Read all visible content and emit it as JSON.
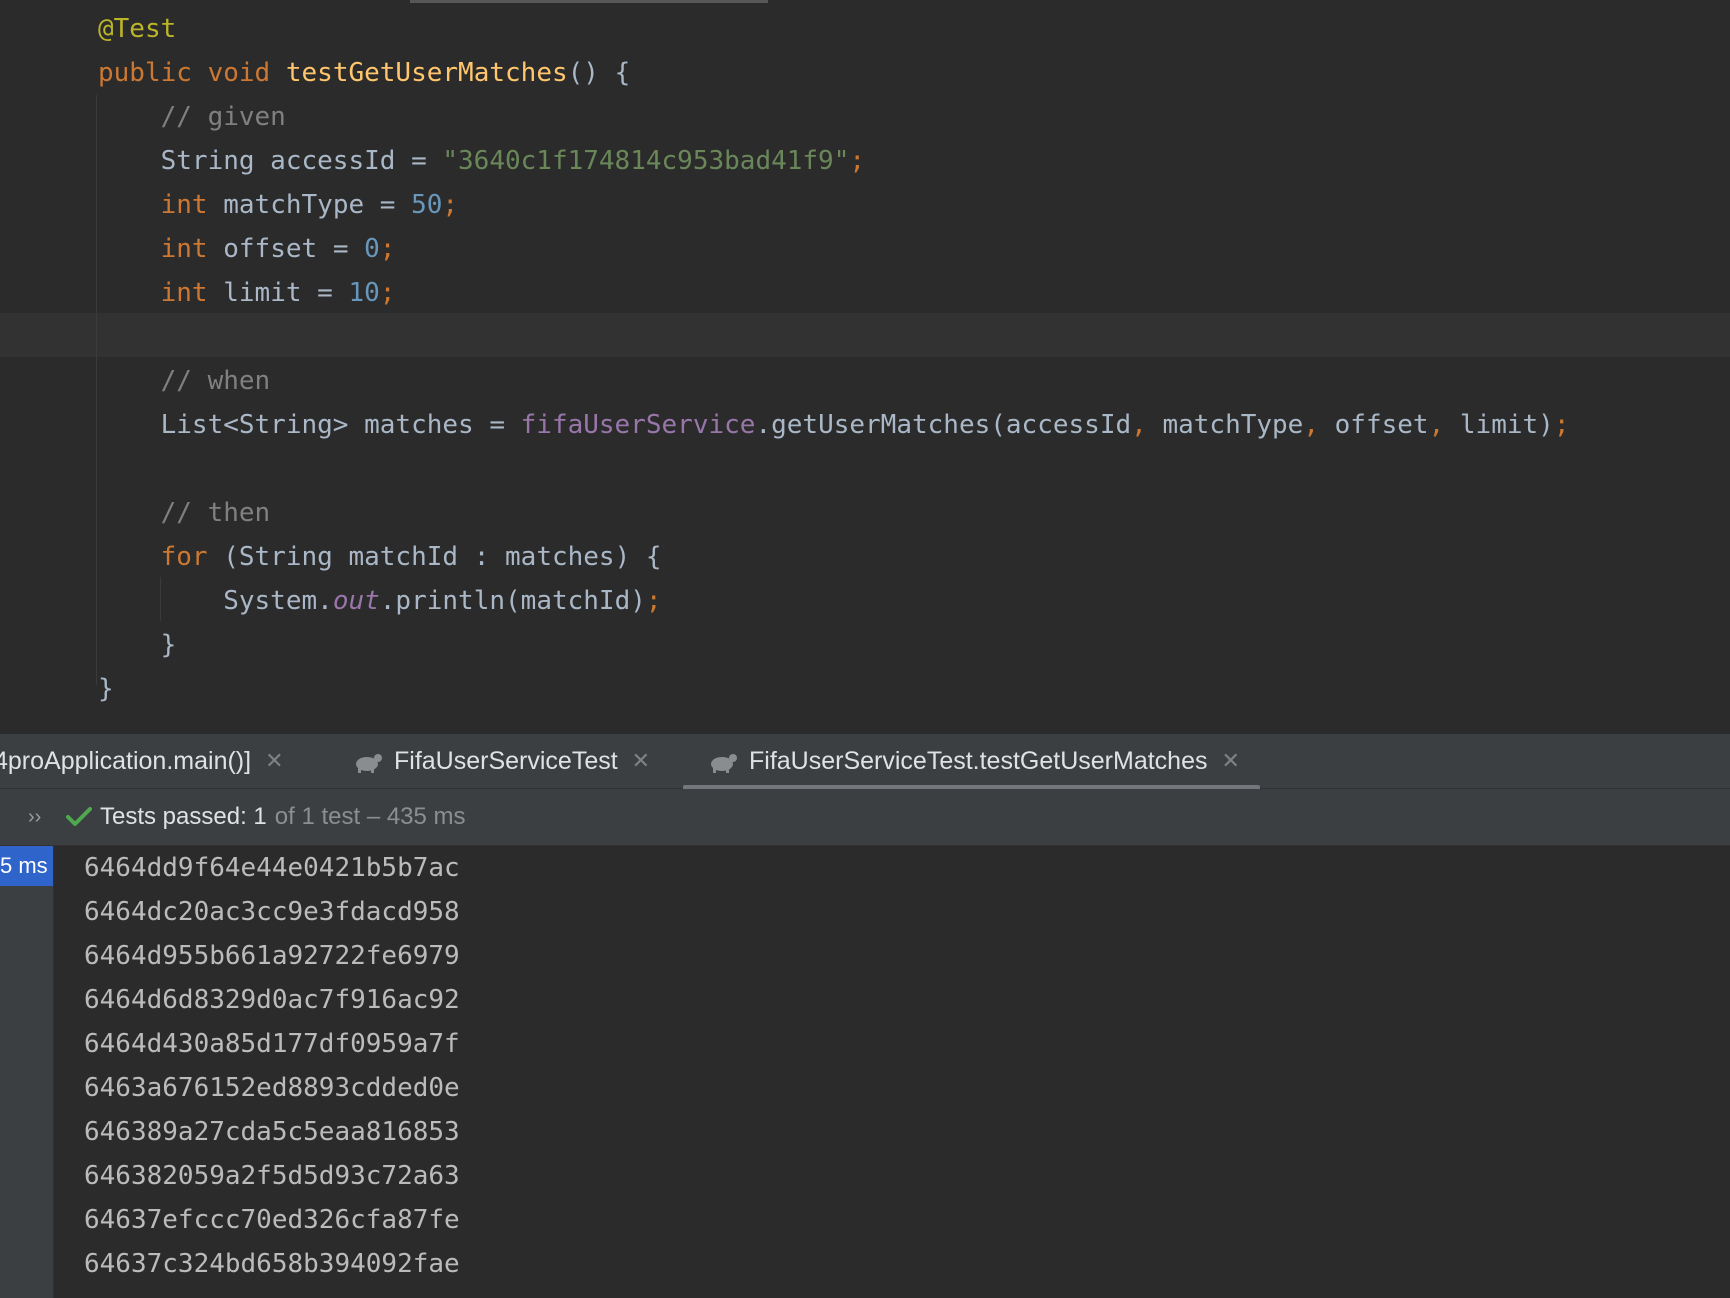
{
  "editor": {
    "lines": [
      [
        {
          "t": "@Test",
          "c": "ann"
        }
      ],
      [
        {
          "t": "public ",
          "c": "kw"
        },
        {
          "t": "void ",
          "c": "kw"
        },
        {
          "t": "testGetUserMatches",
          "c": "fn"
        },
        {
          "t": "() {",
          "c": "pl"
        }
      ],
      [
        {
          "t": "    // given",
          "c": "cmt"
        }
      ],
      [
        {
          "t": "    String accessId = ",
          "c": "pl"
        },
        {
          "t": "\"3640c1f174814c953bad41f9\"",
          "c": "str"
        },
        {
          "t": ";",
          "c": "kw"
        }
      ],
      [
        {
          "t": "    ",
          "c": "pl"
        },
        {
          "t": "int ",
          "c": "kw"
        },
        {
          "t": "matchType = ",
          "c": "pl"
        },
        {
          "t": "50",
          "c": "num"
        },
        {
          "t": ";",
          "c": "kw"
        }
      ],
      [
        {
          "t": "    ",
          "c": "pl"
        },
        {
          "t": "int ",
          "c": "kw"
        },
        {
          "t": "offset = ",
          "c": "pl"
        },
        {
          "t": "0",
          "c": "num"
        },
        {
          "t": ";",
          "c": "kw"
        }
      ],
      [
        {
          "t": "    ",
          "c": "pl"
        },
        {
          "t": "int ",
          "c": "kw"
        },
        {
          "t": "limit = ",
          "c": "pl"
        },
        {
          "t": "10",
          "c": "num"
        },
        {
          "t": ";",
          "c": "kw"
        }
      ],
      [
        {
          "t": "",
          "c": "pl"
        }
      ],
      [
        {
          "t": "    // when",
          "c": "cmt"
        }
      ],
      [
        {
          "t": "    List<String> matches = ",
          "c": "pl"
        },
        {
          "t": "fifaUserService",
          "c": "fld"
        },
        {
          "t": ".getUserMatches(accessId",
          "c": "pl"
        },
        {
          "t": ", ",
          "c": "kw"
        },
        {
          "t": "matchType",
          "c": "pl"
        },
        {
          "t": ", ",
          "c": "kw"
        },
        {
          "t": "offset",
          "c": "pl"
        },
        {
          "t": ", ",
          "c": "kw"
        },
        {
          "t": "limit)",
          "c": "pl"
        },
        {
          "t": ";",
          "c": "kw"
        }
      ],
      [
        {
          "t": "",
          "c": "pl"
        }
      ],
      [
        {
          "t": "    // then",
          "c": "cmt"
        }
      ],
      [
        {
          "t": "    ",
          "c": "pl"
        },
        {
          "t": "for ",
          "c": "kw"
        },
        {
          "t": "(String matchId : matches) {",
          "c": "pl"
        }
      ],
      [
        {
          "t": "        System.",
          "c": "pl"
        },
        {
          "t": "out",
          "c": "sfld"
        },
        {
          "t": ".println(matchId)",
          "c": "pl"
        },
        {
          "t": ";",
          "c": "kw"
        }
      ],
      [
        {
          "t": "    }",
          "c": "pl"
        }
      ],
      [
        {
          "t": "}",
          "c": "pl"
        }
      ]
    ]
  },
  "run_tabs": [
    {
      "label": "4proApplication.main()]",
      "icon": "",
      "active": false
    },
    {
      "label": "FifaUserServiceTest",
      "icon": "test-run-icon",
      "active": false
    },
    {
      "label": "FifaUserServiceTest.testGetUserMatches",
      "icon": "test-run-icon",
      "active": true
    }
  ],
  "status": {
    "expand_glyph": "››",
    "passed_label": "Tests passed: 1",
    "detail": "of 1 test – 435 ms",
    "icon": "check-icon",
    "color": "#4fa84f"
  },
  "tree": {
    "selected_duration": "5 ms"
  },
  "console": {
    "lines": [
      "6464dd9f64e44e0421b5b7ac",
      "6464dc20ac3cc9e3fdacd958",
      "6464d955b661a92722fe6979",
      "6464d6d8329d0ac7f916ac92",
      "6464d430a85d177df0959a7f",
      "6463a676152ed8893cdded0e",
      "646389a27cda5c5eaa816853",
      "646382059a2f5d5d93c72a63",
      "64637efccc70ed326cfa87fe",
      "64637c324bd658b394092fae"
    ]
  },
  "colors": {
    "editor_bg": "#2b2b2b",
    "panel_bg": "#3c3f41",
    "keyword": "#cc7832",
    "string": "#6a8759",
    "number": "#6897bb",
    "annotation": "#bbb529",
    "method": "#ffc66d",
    "field": "#9876aa",
    "comment": "#808080",
    "selection": "#2f65ca"
  }
}
